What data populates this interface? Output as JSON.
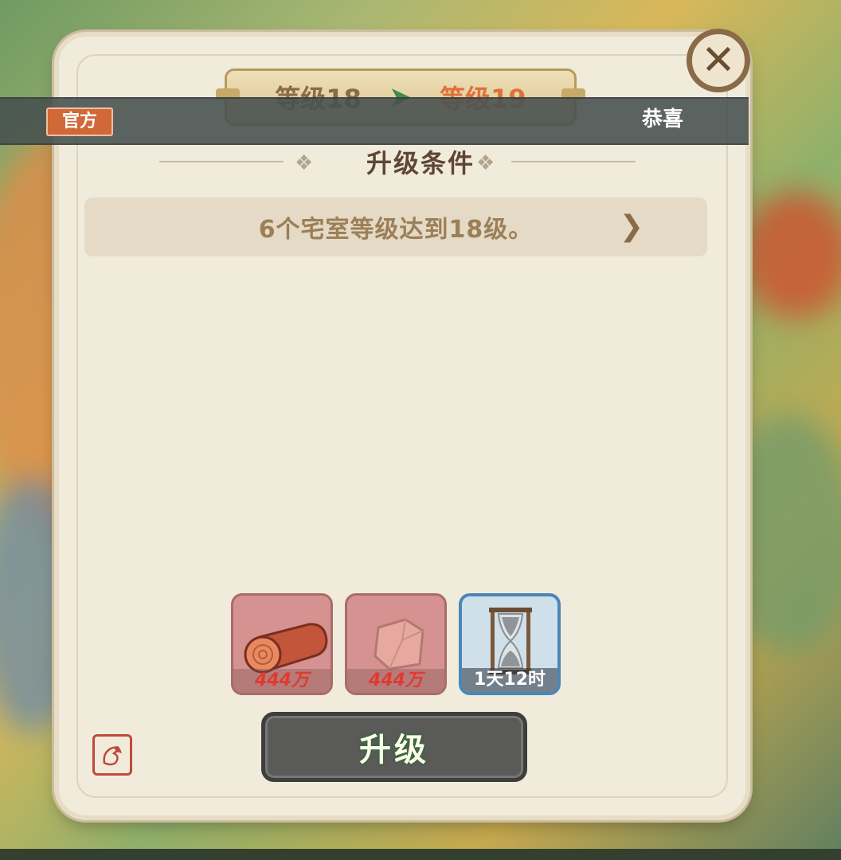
{
  "header": {
    "level_from": "等级18",
    "level_to": "等级19"
  },
  "marquee": {
    "badge": "官方",
    "text": "恭喜"
  },
  "conditions": {
    "title": "升级条件",
    "items": [
      "6个宅室等级达到18级。"
    ]
  },
  "costs": [
    {
      "item": "wood-log-icon",
      "amount": "444万"
    },
    {
      "item": "stone-icon",
      "amount": "444万"
    },
    {
      "item": "hourglass-icon",
      "amount": "1天12时"
    }
  ],
  "actions": {
    "upgrade_label": "升级"
  },
  "colors": {
    "panel": "#f1ebdc",
    "level_target": "#e0703a",
    "cost_red": "#e03a32",
    "button": "#5a5b58"
  }
}
